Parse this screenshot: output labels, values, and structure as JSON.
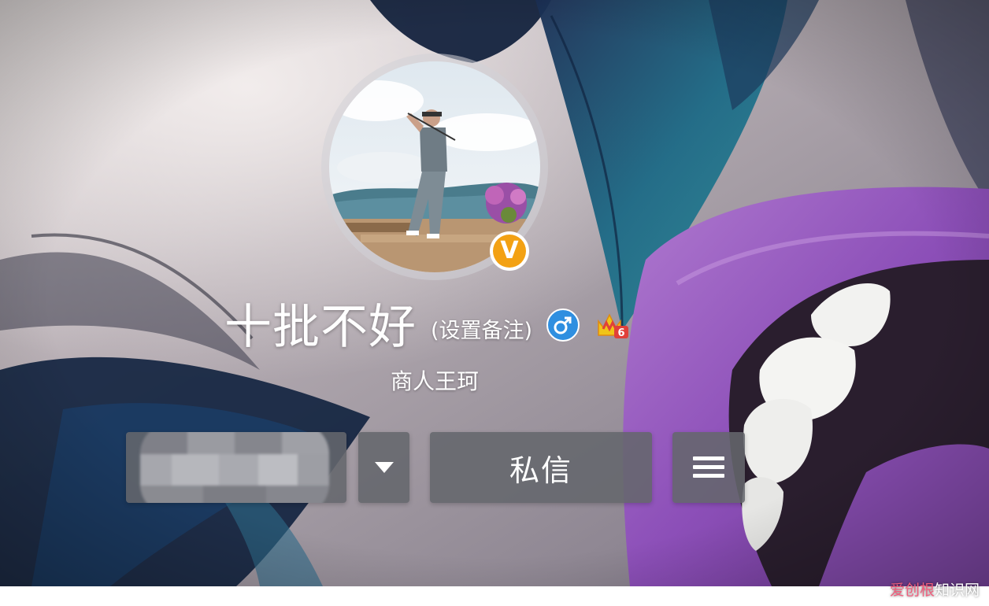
{
  "profile": {
    "name": "十批不好",
    "remark_link": "(设置备注)",
    "subtitle": "商人王珂",
    "gender_symbol": "♂",
    "verified_symbol": "V",
    "vip_level": "6"
  },
  "actions": {
    "message_label": "私信"
  },
  "icons": {
    "verified": "verified-v-icon",
    "gender": "male-icon",
    "vip": "vip-level-icon",
    "dropdown": "caret-down-icon",
    "menu": "hamburger-menu-icon"
  },
  "colors": {
    "verified_badge": "#f3a113",
    "gender_badge": "#2f8fe0",
    "vip_badge": "#f0c419",
    "button_bg": "#64666c"
  },
  "watermark": {
    "accent_text": "爱创根",
    "rest_text": "知识网"
  }
}
